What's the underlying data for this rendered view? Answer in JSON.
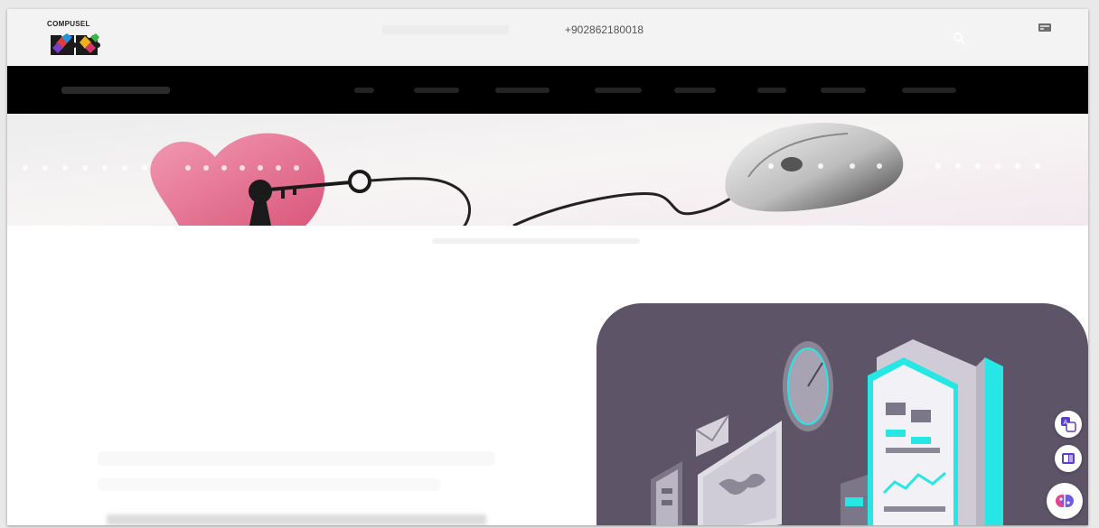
{
  "header": {
    "brand": "COMPUSEL",
    "phone": "+902862180018",
    "search_icon": "search-icon",
    "cart_icon": "card-icon"
  },
  "colors": {
    "topbar": "#f3f3f3",
    "navbar": "#000000",
    "illustration_bg": "#5d5468",
    "accent_cyan": "#27e6e6",
    "heart_pink": "#e86f8b"
  },
  "side_widgets": [
    {
      "icon": "translate-icon"
    },
    {
      "icon": "book-icon"
    },
    {
      "icon": "brain-icon"
    }
  ]
}
